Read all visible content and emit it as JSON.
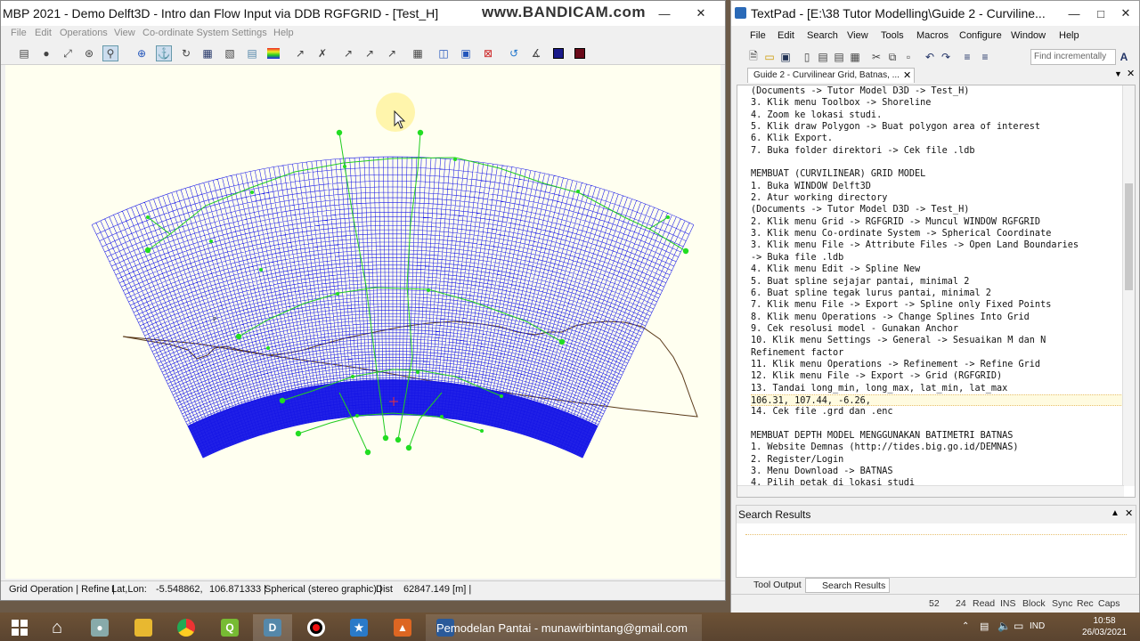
{
  "rgfgrid": {
    "title": "MBP 2021 - Demo Delft3D - Intro dan Flow Input via DDB RGFGRID - [Test_H]",
    "overlay": "www.BANDICAM.com",
    "menu": [
      "File",
      "Edit",
      "Operations",
      "View",
      "Co-ordinate System",
      "Settings",
      "Help"
    ],
    "status": {
      "mode": "Grid Operation | Refine |",
      "latlon_label": "Lat,Lon:",
      "lat": "-5.548862,",
      "lon": "106.871333 |",
      "projection": "Spherical (stereo graphic) |",
      "dist_label": "Dist",
      "dist": "62847.149 [m] |"
    },
    "canvas_marker": "P",
    "colors": {
      "grid": "#1414e6",
      "spline": "#22cc22",
      "land": "#5a3a1a",
      "canvas": "#fffff0"
    }
  },
  "textpad": {
    "title": "TextPad - [E:\\38 Tutor Modelling\\Guide 2 - Curviline...",
    "menu": [
      "File",
      "Edit",
      "Search",
      "View",
      "Tools",
      "Macros",
      "Configure",
      "Window",
      "Help"
    ],
    "find_placeholder": "Find incrementally",
    "tab_label": "Guide 2 - Curvilinear Grid, Batnas, ...",
    "lines": [
      "(Documents -> Tutor Model D3D -> Test_H)",
      "3. Klik menu Toolbox -> Shoreline",
      "4. Zoom ke lokasi studi.",
      "5. Klik draw Polygon -> Buat polygon area of interest",
      "6. Klik Export.",
      "7. Buka folder direktori -> Cek file .ldb",
      "",
      "MEMBUAT (CURVILINEAR) GRID MODEL",
      "1. Buka WINDOW Delft3D",
      "2. Atur working directory",
      "(Documents -> Tutor Model D3D -> Test_H)",
      "2. Klik menu Grid -> RGFGRID -> Muncul WINDOW RGFGRID",
      "3. Klik menu Co-ordinate System -> Spherical Coordinate",
      "3. Klik menu File -> Attribute Files -> Open Land Boundaries",
      "-> Buka file .ldb",
      "4. Klik menu Edit -> Spline New",
      "5. Buat spline sejajar pantai, minimal 2",
      "6. Buat spline tegak lurus pantai, minimal 2",
      "7. Klik menu File -> Export -> Spline only Fixed Points",
      "8. Klik menu Operations -> Change Splines Into Grid",
      "9. Cek resolusi model - Gunakan Anchor",
      "10. Klik menu Settings -> General -> Sesuaikan M dan N",
      "Refinement factor",
      "11. Klik menu Operations -> Refinement -> Refine Grid",
      "12. Klik menu File -> Export -> Grid (RGFGRID)",
      "13. Tandai long_min, long_max, lat_min, lat_max",
      "106.31, 107.44, -6.26,",
      "14. Cek file .grd dan .enc",
      "",
      "MEMBUAT DEPTH MODEL MENGGUNAKAN BATIMETRI BATNAS",
      "1. Website Demnas (http://tides.big.go.id/DEMNAS)",
      "2. Register/Login",
      "3. Menu Download -> BATNAS",
      "4. Pilih petak di lokasi studi"
    ],
    "search_results_title": "Search Results",
    "bottom_tabs": [
      "Tool Output",
      "Search Results"
    ],
    "status": [
      "52",
      "24",
      "Read",
      "INS",
      "Block",
      "Sync",
      "Rec",
      "Caps"
    ]
  },
  "taskbar": {
    "active_label": "Pemodelan Pantai - munawirbintang@gmail.com",
    "lang": "IND",
    "time": "10:58",
    "date": "26/03/2021"
  }
}
